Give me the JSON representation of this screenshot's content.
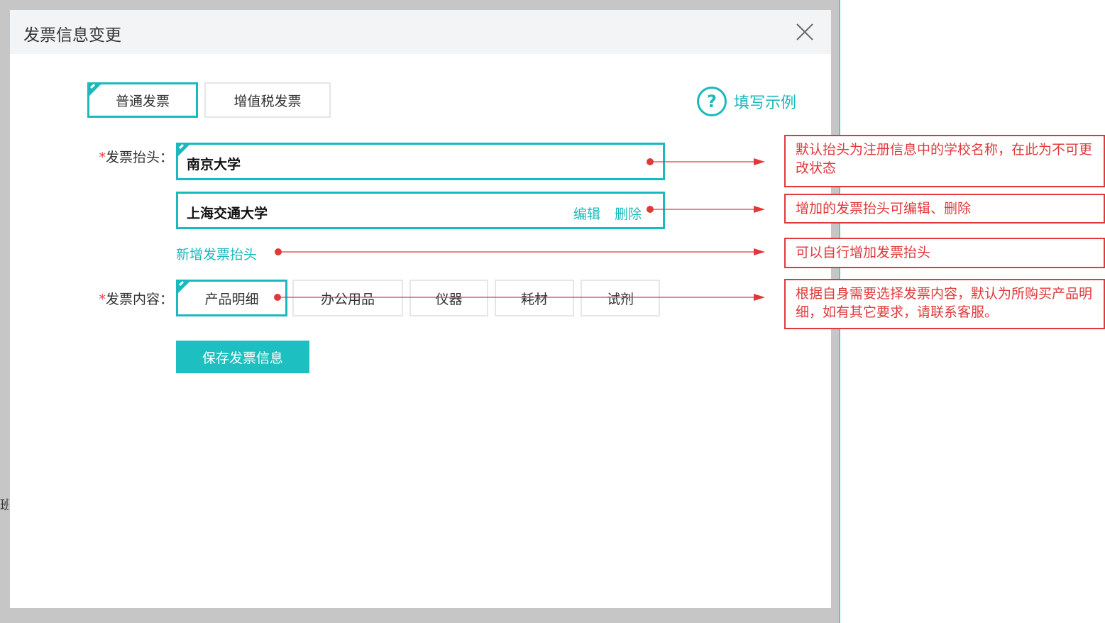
{
  "modal": {
    "title": "发票信息变更",
    "invoice_types": [
      "普通发票",
      "增值税发票"
    ],
    "help_label": "填写示例",
    "help_symbol": "?",
    "title_field_label": "发票抬头：",
    "required_mark": "*",
    "default_title": "南京大学",
    "added_title": "上海交通大学",
    "edit_label": "编辑",
    "delete_label": "删除",
    "add_title_label": "新增发票抬头",
    "content_field_label": "发票内容：",
    "content_options": [
      "产品明细",
      "办公用品",
      "仪器",
      "耗材",
      "试剂"
    ],
    "save_label": "保存发票信息"
  },
  "backdrop": {
    "partial_text": "班"
  },
  "annotations": [
    "默认抬头为注册信息中的学校名称，在此为不可更改状态",
    "增加的发票抬头可编辑、删除",
    "可以自行增加发票抬头",
    "根据自身需要选择发票内容，默认为所购买产品明细，如有其它要求，请联系客服。"
  ],
  "colors": {
    "accent": "#1ab9bd",
    "annotation": "#e0393b",
    "required": "#e8413e",
    "header_bg": "#f2f4f5"
  }
}
